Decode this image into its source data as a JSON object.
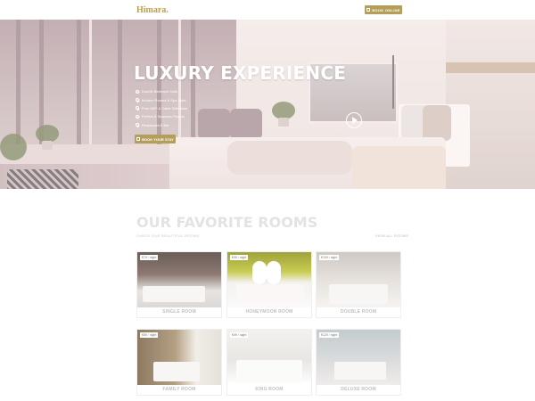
{
  "header": {
    "brand": "Himara.",
    "book_button": "BOOK ONLINE"
  },
  "hero": {
    "title": "LUXURY EXPERIENCE",
    "features": [
      "Double Bedroom Suite",
      "Modern Rooms & Spa Suite",
      "Free WiFi & Cable Television",
      "Perfect & Spacious Rooms",
      "Restaurant & Bar"
    ],
    "stay_button": "BOOK YOUR STAY"
  },
  "rooms": {
    "title": "OUR FAVORITE ROOMS",
    "subtitle": "CHECK OUR BEAUTIFUL ROOMS",
    "view_all": "VIEW ALL ROOMS",
    "items": [
      {
        "name": "SINGLE ROOM",
        "price": "€79 / night"
      },
      {
        "name": "HONEYMOON ROOM",
        "price": "€99 / night"
      },
      {
        "name": "DOUBLE ROOM",
        "price": "€109 / night"
      },
      {
        "name": "FAMILY ROOM",
        "price": "€89 / night"
      },
      {
        "name": "KING ROOM",
        "price": "€99 / night"
      },
      {
        "name": "DELUXE ROOM",
        "price": "€129 / night"
      }
    ]
  },
  "icons": {
    "calendar": "calendar-icon",
    "check": "check-circle-icon",
    "play": "play-icon"
  },
  "colors": {
    "accent": "#b59e5a",
    "brand": "#b8a24f",
    "muted_heading": "#e3e3e3"
  }
}
